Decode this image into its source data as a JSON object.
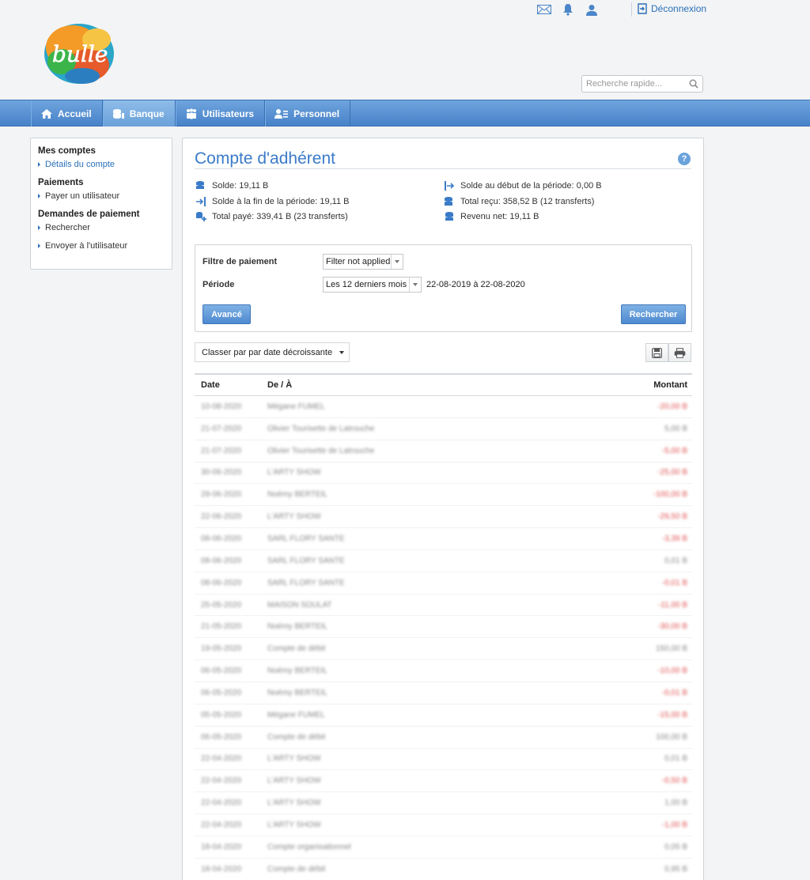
{
  "header": {
    "logout_label": "Déconnexion",
    "search_placeholder": "Recherche rapide...",
    "top_icons": [
      "mail-icon",
      "bell-icon",
      "user-icon"
    ]
  },
  "nav": {
    "items": [
      {
        "label": "Accueil",
        "icon": "home-icon"
      },
      {
        "label": "Banque",
        "icon": "bank-icon",
        "active": true
      },
      {
        "label": "Utilisateurs",
        "icon": "users-icon"
      },
      {
        "label": "Personnel",
        "icon": "staff-icon"
      }
    ]
  },
  "sidebar": {
    "groups": [
      {
        "title": "Mes comptes",
        "items": [
          "Détails du compte"
        ]
      },
      {
        "title": "Paiements",
        "items": [
          "Payer un utilisateur"
        ]
      },
      {
        "title": "Demandes de paiement",
        "items": [
          "Rechercher",
          "Envoyer à l'utilisateur"
        ]
      }
    ]
  },
  "main": {
    "title": "Compte d'adhérent",
    "stats": {
      "solde": "Solde: 19,11 B",
      "solde_debut": "Solde au début de la période: 0,00 B",
      "solde_fin": "Solde à la fin de la période: 19,11 B",
      "total_recu": "Total reçu: 358,52 B (12 transferts)",
      "total_paye": "Total payé: 339,41 B (23 transferts)",
      "revenu_net": "Revenu net: 19,11 B"
    },
    "filter": {
      "label_filtre": "Filtre de paiement",
      "filtre_value": "Filter not applied",
      "label_periode": "Période",
      "periode_value": "Les 12 derniers mois",
      "periode_range": "22-08-2019 à 22-08-2020",
      "advanced_label": "Avancé",
      "search_label": "Rechercher"
    },
    "sort_label": "Classer par par date décroissante",
    "table": {
      "columns": [
        "Date",
        "De / À",
        "Montant"
      ],
      "rows": [
        {
          "date": "10-08-2020",
          "who": "Mégane FUMEL",
          "amount": "-20,00 B",
          "neg": true
        },
        {
          "date": "21-07-2020",
          "who": "Olivier Tourisette de Latrouche",
          "amount": "5,00 B",
          "neg": false
        },
        {
          "date": "21-07-2020",
          "who": "Olivier Tourisette de Latrouche",
          "amount": "-5,00 B",
          "neg": true
        },
        {
          "date": "30-06-2020",
          "who": "L'ARTY SHOW",
          "amount": "-25,00 B",
          "neg": true
        },
        {
          "date": "29-06-2020",
          "who": "Noémy BERTEIL",
          "amount": "-100,00 B",
          "neg": true
        },
        {
          "date": "22-06-2020",
          "who": "L'ARTY SHOW",
          "amount": "-29,50 B",
          "neg": true
        },
        {
          "date": "08-06-2020",
          "who": "SARL FLORY SANTE",
          "amount": "-3,39 B",
          "neg": true
        },
        {
          "date": "08-06-2020",
          "who": "SARL FLORY SANTE",
          "amount": "0,01 B",
          "neg": false
        },
        {
          "date": "08-06-2020",
          "who": "SARL FLORY SANTE",
          "amount": "-0,01 B",
          "neg": true
        },
        {
          "date": "25-05-2020",
          "who": "MAISON SOULAT",
          "amount": "-11,00 B",
          "neg": true
        },
        {
          "date": "21-05-2020",
          "who": "Noémy BERTEIL",
          "amount": "-30,00 B",
          "neg": true
        },
        {
          "date": "19-05-2020",
          "who": "Compte de débit",
          "amount": "150,00 B",
          "neg": false
        },
        {
          "date": "06-05-2020",
          "who": "Noémy BERTEIL",
          "amount": "-10,00 B",
          "neg": true
        },
        {
          "date": "06-05-2020",
          "who": "Noémy BERTEIL",
          "amount": "-0,01 B",
          "neg": true
        },
        {
          "date": "05-05-2020",
          "who": "Mégane FUMEL",
          "amount": "-15,00 B",
          "neg": true
        },
        {
          "date": "06-05-2020",
          "who": "Compte de débit",
          "amount": "100,00 B",
          "neg": false
        },
        {
          "date": "22-04-2020",
          "who": "L'ARTY SHOW",
          "amount": "0,01 B",
          "neg": false
        },
        {
          "date": "22-04-2020",
          "who": "L'ARTY SHOW",
          "amount": "-0,50 B",
          "neg": true
        },
        {
          "date": "22-04-2020",
          "who": "L'ARTY SHOW",
          "amount": "1,00 B",
          "neg": false
        },
        {
          "date": "22-04-2020",
          "who": "L'ARTY SHOW",
          "amount": "-1,00 B",
          "neg": true
        },
        {
          "date": "18-04-2020",
          "who": "Compte organisationnel",
          "amount": "0,05 B",
          "neg": false
        },
        {
          "date": "18-04-2020",
          "who": "Compte de débit",
          "amount": "0,95 B",
          "neg": false
        }
      ]
    }
  },
  "colors": {
    "accent": "#3a7bc8",
    "nav": "#5a93d3",
    "negative": "#e05050"
  }
}
